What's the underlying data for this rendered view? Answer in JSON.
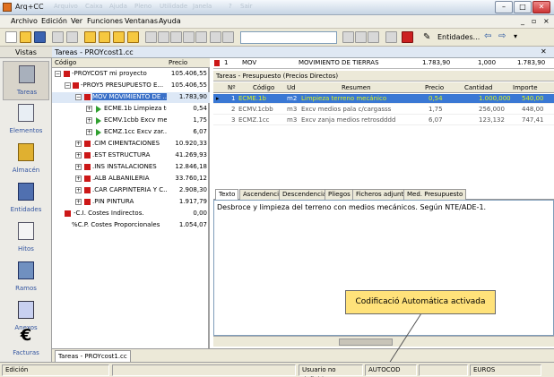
{
  "window": {
    "title": "Arq+CC",
    "ghost_menu": [
      "Arquivo",
      "Caixa",
      "Ajuda",
      "Pleno",
      "Utilidade",
      "Janela"
    ],
    "ghost_buttons": [
      "?",
      "Sair"
    ]
  },
  "menu": [
    "Archivo",
    "Edición",
    "Ver",
    "Funciones",
    "Ventanas",
    "Ayuda"
  ],
  "toolbar": {
    "entities_label": "Entidades..."
  },
  "vistas": {
    "header": "Vistas",
    "items": [
      {
        "label": "Tareas",
        "icon": "tasks-icon",
        "selected": true
      },
      {
        "label": "Elementos",
        "icon": "elements-icon"
      },
      {
        "label": "Almacén",
        "icon": "warehouse-icon"
      },
      {
        "label": "Entidades",
        "icon": "entities-icon"
      },
      {
        "label": "Hitos",
        "icon": "milestones-icon"
      },
      {
        "label": "Ramos",
        "icon": "branches-icon"
      },
      {
        "label": "Anexos",
        "icon": "attachments-icon"
      },
      {
        "label": "Facturas",
        "icon": "euro-icon"
      }
    ]
  },
  "main": {
    "header": "Tareas - PROYcost1.cc",
    "tree_headers": {
      "code": "Código",
      "price": "Precio"
    },
    "tree": [
      {
        "code": "-PROYCOST",
        "desc": "mi proyecto",
        "price": "105.406,55"
      },
      {
        "code": "-PROY5",
        "desc": "PRESUPUESTO E...",
        "price": "105.406,55"
      },
      {
        "code": "MOV",
        "desc": "MOVIMIENTO DE ...",
        "price": "1.783,90"
      },
      {
        "code": "ECME.1b",
        "desc": "Limpieza te...",
        "price": "0,54"
      },
      {
        "code": "ECMV.1cbb",
        "desc": "Excv me...",
        "price": "1,75"
      },
      {
        "code": "ECMZ.1cc",
        "desc": "Excv zar...",
        "price": "6,07"
      },
      {
        "code": ".CIM",
        "desc": "CIMENTACIONES",
        "price": "10.920,33"
      },
      {
        "code": ".EST",
        "desc": "ESTRUCTURA",
        "price": "41.269,93"
      },
      {
        "code": ".INS",
        "desc": "INSTALACIONES",
        "price": "12.846,18"
      },
      {
        "code": ".ALB",
        "desc": "ALBAÑILERIA",
        "price": "33.760,12"
      },
      {
        "code": ".CAR",
        "desc": "CARPINTERIA Y C...",
        "price": "2.908,30"
      },
      {
        "code": ".PIN",
        "desc": "PINTURA",
        "price": "1.917,79"
      },
      {
        "code": "-C.I.",
        "desc": "Costes Indirectos.",
        "price": "0,00"
      },
      {
        "code": "%C.P.",
        "desc": "Costes Proporcionales",
        "price": "1.054,07"
      }
    ],
    "topline": {
      "num": "1",
      "code": "MOV",
      "desc": "MOVIMIENTO DE TIERRAS",
      "v1": "1.783,90",
      "v2": "1,000",
      "v3": "1.783,90"
    },
    "subpanel_title": "Tareas - Presupuesto (Precios Directos)",
    "grid_headers": {
      "n": "Nº",
      "code": "Código",
      "ud": "Ud",
      "summary": "Resumen",
      "price": "Precio",
      "qty": "Cantidad",
      "amount": "Importe"
    },
    "grid_rows": [
      {
        "n": "1",
        "code": "ECME.1b",
        "ud": "m2",
        "summary": "Limpieza terreno mecánico",
        "price": "0,54",
        "qty": "1.000,000",
        "amount": "540,00"
      },
      {
        "n": "2",
        "code": "ECMV.1cbb",
        "ud": "m3",
        "summary": "Excv medios pala c/cargasss",
        "price": "1,75",
        "qty": "256,000",
        "amount": "448,00"
      },
      {
        "n": "3",
        "code": "ECMZ.1cc",
        "ud": "m3",
        "summary": "Excv zanja medios retrosdddd",
        "price": "6,07",
        "qty": "123,132",
        "amount": "747,41"
      }
    ],
    "tabs": [
      "Texto",
      "Ascendencia",
      "Descendencia",
      "Pliegos",
      "Ficheros adjuntos",
      "Med. Presupuesto"
    ],
    "text": "Desbroce y limpieza del terreno con medios mecánicos. Según NTE/ADE-1.",
    "callout": "Codificació Automática activada",
    "doc_tab": "Tareas - PROYcost1.cc"
  },
  "status": {
    "mode": "Edición",
    "user": "Usuario no definido",
    "autocod": "AUTOCOD",
    "currency": "EUROS"
  }
}
